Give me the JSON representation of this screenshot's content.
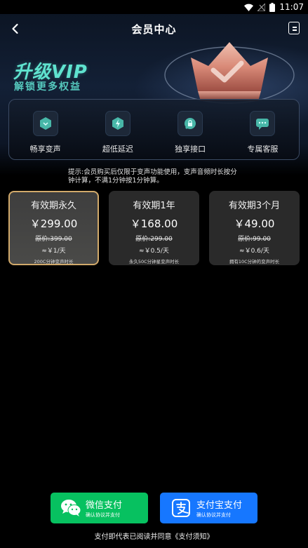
{
  "status_bar": {
    "time": "11:07"
  },
  "nav": {
    "title": "会员中心"
  },
  "banner": {
    "title": "升级VIP",
    "subtitle": "解锁更多权益"
  },
  "features": [
    {
      "label": "畅享变声",
      "icon": "voice-cube-icon"
    },
    {
      "label": "超低延迟",
      "icon": "lightning-icon"
    },
    {
      "label": "独享接口",
      "icon": "lock-speech-icon"
    },
    {
      "label": "专属客服",
      "icon": "chat-bubble-icon"
    }
  ],
  "tip": "提示:会员购买后仅限于变声功能使用，变声音频时长按分钟计算，不满1分钟按1分钟算。",
  "plans": [
    {
      "title": "有效期永久",
      "price": "￥299.00",
      "original": "原价:399.00",
      "per": "≈￥1/天",
      "note": "200C分钟变声时长",
      "selected": true
    },
    {
      "title": "有效期1年",
      "price": "￥168.00",
      "original": "原价:299.00",
      "per": "≈￥0.5/天",
      "note": "永久50C分钟星变声时长",
      "selected": false
    },
    {
      "title": "有效期3个月",
      "price": "￥49.00",
      "original": "原价:99.00",
      "per": "≈￥0.6/天",
      "note": "拥有10C分钟的变声时长",
      "selected": false
    }
  ],
  "payment": {
    "wechat": {
      "label": "微信支付",
      "sub": "确认协议并支付",
      "color": "#07c160"
    },
    "alipay": {
      "label": "支付宝支付",
      "sub": "确认协议并支付",
      "color": "#1677ff"
    }
  },
  "agreement": "支付即代表已阅读并同意《支付须知》"
}
